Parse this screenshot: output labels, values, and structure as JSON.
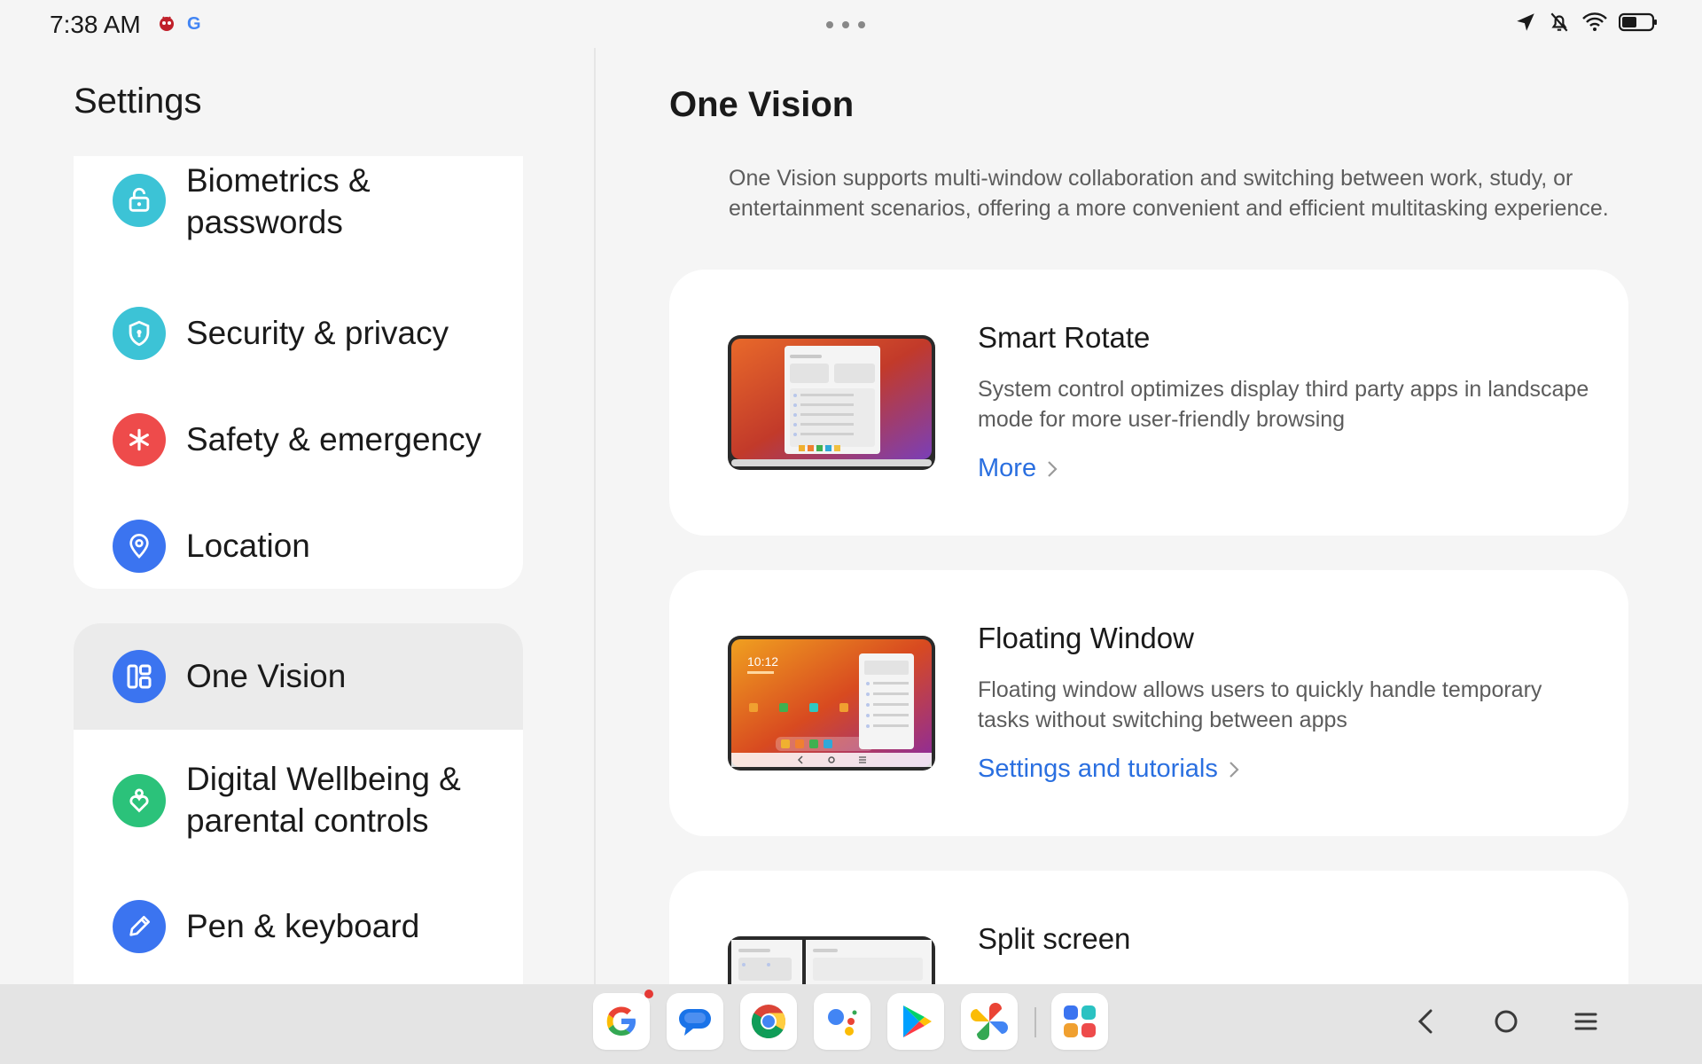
{
  "status_bar": {
    "time": "7:38 AM"
  },
  "left_panel": {
    "title": "Settings",
    "group1": [
      {
        "label": "Biometrics & passwords",
        "icon": "lock-icon",
        "color": "#3cc3d6"
      },
      {
        "label": "Security & privacy",
        "icon": "shield-icon",
        "color": "#3cc3d6"
      },
      {
        "label": "Safety & emergency",
        "icon": "asterisk-icon",
        "color": "#ee4b4b"
      },
      {
        "label": "Location",
        "icon": "location-pin-icon",
        "color": "#3b74f0"
      }
    ],
    "group2": [
      {
        "label": "One Vision",
        "icon": "one-vision-icon",
        "color": "#3b74f0",
        "selected": true
      },
      {
        "label": "Digital Wellbeing & parental controls",
        "icon": "wellbeing-heart-icon",
        "color": "#2bc27a"
      },
      {
        "label": "Pen & keyboard",
        "icon": "pen-icon",
        "color": "#3b74f0"
      }
    ]
  },
  "right_panel": {
    "title": "One Vision",
    "description": "One Vision supports multi-window collaboration and switching between work, study, or entertainment scenarios, offering a more convenient and efficient multitasking experience.",
    "cards": [
      {
        "title": "Smart Rotate",
        "description": "System control optimizes display third party apps in landscape mode for more user-friendly browsing",
        "link": "More"
      },
      {
        "title": "Floating Window",
        "description": "Floating window allows users to quickly handle temporary tasks without switching between apps",
        "link": "Settings and tutorials",
        "image_clock": "10:12"
      },
      {
        "title": "Split screen"
      }
    ]
  },
  "taskbar": {
    "apps": [
      "google-icon",
      "messages-icon",
      "chrome-icon",
      "assistant-icon",
      "play-store-icon",
      "photos-icon",
      "app-drawer-icon"
    ]
  },
  "colors": {
    "accent": "#2a6fe0",
    "background": "#f5f5f5"
  }
}
